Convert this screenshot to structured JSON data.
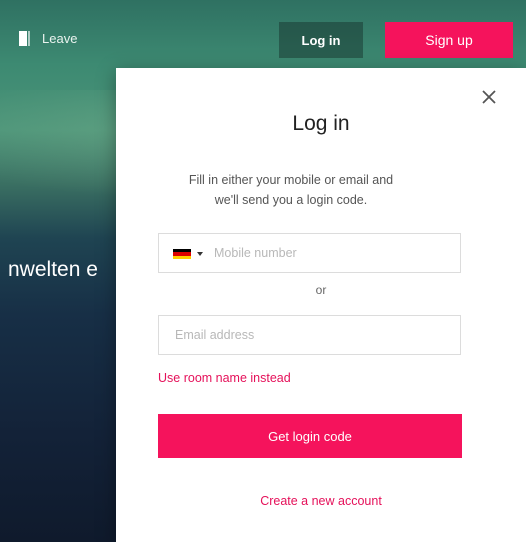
{
  "topbar": {
    "leave_label": "Leave",
    "login_label": "Log in",
    "signup_label": "Sign up",
    "door_icon": "door-icon"
  },
  "background": {
    "partial_text": "nwelten e"
  },
  "modal": {
    "title": "Log in",
    "description": "Fill in either your mobile or email and we'll send you a login code.",
    "close_icon": "close-icon",
    "phone": {
      "country_flag": "flag-germany-icon",
      "flag_colors": [
        "#000000",
        "#dd0000",
        "#ffce00"
      ],
      "placeholder": "Mobile number",
      "value": ""
    },
    "or_label": "or",
    "email": {
      "placeholder": "Email address",
      "value": ""
    },
    "room_link": "Use room name instead",
    "submit_label": "Get login code",
    "create_account_link": "Create a new account"
  },
  "colors": {
    "accent": "#f5135c",
    "link": "#e5115a"
  }
}
